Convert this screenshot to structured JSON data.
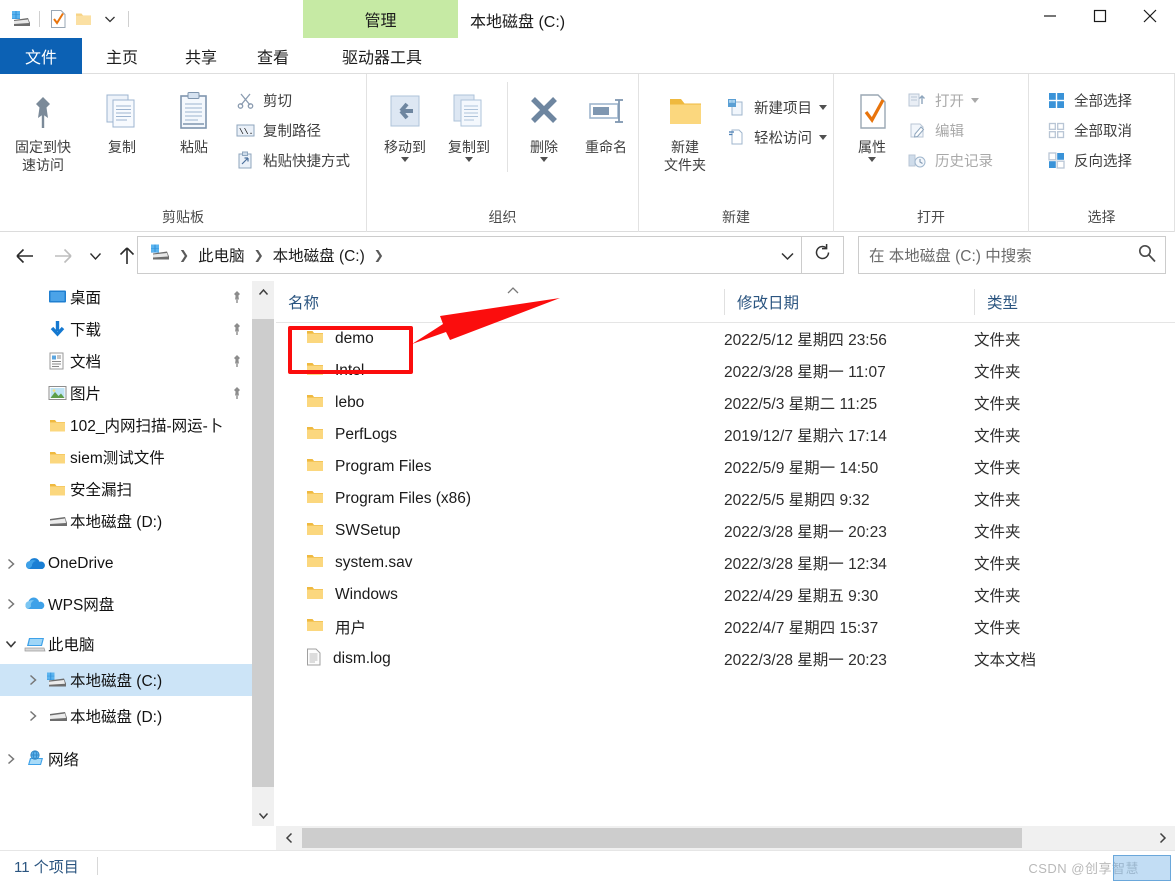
{
  "window": {
    "title": "本地磁盘 (C:)",
    "contextual_tab_header": "管理",
    "quick_access_icons": [
      "drive-icon",
      "properties-icon",
      "new-folder-icon",
      "customize-caret-icon"
    ],
    "controls": {
      "minimize": "minimize-icon",
      "maximize": "maximize-icon",
      "close": "close-icon"
    }
  },
  "tabs": [
    {
      "id": "file",
      "label": "文件"
    },
    {
      "id": "home",
      "label": "主页"
    },
    {
      "id": "share",
      "label": "共享"
    },
    {
      "id": "view",
      "label": "查看"
    },
    {
      "id": "drivetools",
      "label": "驱动器工具"
    }
  ],
  "ribbon": {
    "collapse_label": "^",
    "help_label": "?",
    "groups": [
      {
        "title": "剪贴板",
        "big_buttons": [
          {
            "label": "固定到快\n速访问",
            "line1": "固定到快",
            "line2": "速访问",
            "icon": "pin-icon"
          },
          {
            "label": "复制",
            "icon": "copy-icon"
          },
          {
            "label": "粘贴",
            "icon": "paste-icon"
          }
        ],
        "small_buttons": [
          {
            "label": "剪切",
            "icon": "scissors-icon"
          },
          {
            "label": "复制路径",
            "icon": "copy-path-icon"
          },
          {
            "label": "粘贴快捷方式",
            "icon": "paste-shortcut-icon"
          }
        ]
      },
      {
        "title": "组织",
        "big_buttons": [
          {
            "label": "移动到",
            "icon": "move-to-icon",
            "has_caret": true
          },
          {
            "label": "复制到",
            "icon": "copy-to-icon",
            "has_caret": true
          },
          {
            "label": "删除",
            "icon": "delete-icon",
            "has_caret": true
          },
          {
            "label": "重命名",
            "icon": "rename-icon"
          }
        ],
        "small_buttons": []
      },
      {
        "title": "新建",
        "big_buttons": [
          {
            "label": "新建\n文件夹",
            "line1": "新建",
            "line2": "文件夹",
            "icon": "new-folder-icon"
          }
        ],
        "small_buttons": [
          {
            "label": "新建项目",
            "icon": "new-item-icon",
            "has_caret": true
          },
          {
            "label": "轻松访问",
            "icon": "easy-access-icon",
            "has_caret": true
          }
        ]
      },
      {
        "title": "打开",
        "big_buttons": [
          {
            "label": "属性",
            "icon": "properties-icon",
            "has_caret": true
          }
        ],
        "small_buttons": [
          {
            "label": "打开",
            "icon": "open-icon",
            "has_caret": true,
            "disabled": true
          },
          {
            "label": "编辑",
            "icon": "edit-icon",
            "disabled": true
          },
          {
            "label": "历史记录",
            "icon": "history-icon",
            "disabled": true
          }
        ]
      },
      {
        "title": "选择",
        "big_buttons": [],
        "small_buttons": [
          {
            "label": "全部选择",
            "icon": "select-all-icon"
          },
          {
            "label": "全部取消",
            "icon": "select-none-icon"
          },
          {
            "label": "反向选择",
            "icon": "invert-selection-icon"
          }
        ]
      }
    ]
  },
  "address": {
    "back_icon": "back-arrow-icon",
    "forward_icon": "forward-arrow-icon",
    "recent_icon": "recent-locations-caret-icon",
    "up_icon": "up-arrow-icon",
    "breadcrumbs": [
      "此电脑",
      "本地磁盘 (C:)"
    ],
    "refresh_icon": "refresh-icon"
  },
  "search": {
    "placeholder": "在 本地磁盘 (C:) 中搜索",
    "icon": "search-icon"
  },
  "sidebar": {
    "items": [
      {
        "label": "桌面",
        "icon": "desktop-icon",
        "indent": 1,
        "chevron": "",
        "pinned": true
      },
      {
        "label": "下载",
        "icon": "downloads-icon",
        "indent": 1,
        "chevron": "",
        "pinned": true
      },
      {
        "label": "文档",
        "icon": "documents-icon",
        "indent": 1,
        "chevron": "",
        "pinned": true
      },
      {
        "label": "图片",
        "icon": "pictures-icon",
        "indent": 1,
        "chevron": "",
        "pinned": true
      },
      {
        "label": "102_内网扫描-网运-卜",
        "icon": "folder-icon",
        "indent": 1,
        "chevron": "",
        "pinned": false
      },
      {
        "label": "siem测试文件",
        "icon": "folder-icon",
        "indent": 1,
        "chevron": "",
        "pinned": false
      },
      {
        "label": "安全漏扫",
        "icon": "folder-icon",
        "indent": 1,
        "chevron": "",
        "pinned": false
      },
      {
        "label": "本地磁盘 (D:)",
        "icon": "drive-icon",
        "indent": 1,
        "chevron": "",
        "pinned": false
      },
      {
        "label": "OneDrive",
        "icon": "onedrive-icon",
        "indent": 0,
        "chevron": "right",
        "pinned": false
      },
      {
        "label": "WPS网盘",
        "icon": "wps-cloud-icon",
        "indent": 0,
        "chevron": "right",
        "pinned": false
      },
      {
        "label": "此电脑",
        "icon": "this-pc-icon",
        "indent": 0,
        "chevron": "down",
        "pinned": false
      },
      {
        "label": "本地磁盘 (C:)",
        "icon": "windows-drive-icon",
        "indent": 1,
        "chevron": "right",
        "pinned": false,
        "selected": true
      },
      {
        "label": "本地磁盘 (D:)",
        "icon": "drive-icon",
        "indent": 1,
        "chevron": "right",
        "pinned": false
      },
      {
        "label": "网络",
        "icon": "network-icon",
        "indent": 0,
        "chevron": "right",
        "pinned": false
      }
    ]
  },
  "filelist": {
    "columns": [
      "名称",
      "修改日期",
      "类型"
    ],
    "sort_indicator": "ascending",
    "rows": [
      {
        "name": "demo",
        "icon": "folder-icon",
        "date": "2022/5/12 星期四 23:56",
        "type": "文件夹",
        "highlighted": true
      },
      {
        "name": "Intel",
        "icon": "folder-icon",
        "date": "2022/3/28 星期一 11:07",
        "type": "文件夹"
      },
      {
        "name": "lebo",
        "icon": "folder-icon",
        "date": "2022/5/3 星期二 11:25",
        "type": "文件夹"
      },
      {
        "name": "PerfLogs",
        "icon": "folder-icon",
        "date": "2019/12/7 星期六 17:14",
        "type": "文件夹"
      },
      {
        "name": "Program Files",
        "icon": "folder-icon",
        "date": "2022/5/9 星期一 14:50",
        "type": "文件夹"
      },
      {
        "name": "Program Files (x86)",
        "icon": "folder-icon",
        "date": "2022/5/5 星期四 9:32",
        "type": "文件夹"
      },
      {
        "name": "SWSetup",
        "icon": "folder-icon",
        "date": "2022/3/28 星期一 20:23",
        "type": "文件夹"
      },
      {
        "name": "system.sav",
        "icon": "folder-icon",
        "date": "2022/3/28 星期一 12:34",
        "type": "文件夹"
      },
      {
        "name": "Windows",
        "icon": "folder-icon",
        "date": "2022/4/29 星期五 9:30",
        "type": "文件夹"
      },
      {
        "name": "用户",
        "icon": "folder-icon",
        "date": "2022/4/7 星期四 15:37",
        "type": "文件夹"
      },
      {
        "name": "dism.log",
        "icon": "textfile-icon",
        "date": "2022/3/28 星期一 20:23",
        "type": "文本文档"
      }
    ]
  },
  "statusbar": {
    "item_count": "11 个项目"
  },
  "annotation": {
    "highlight_target": "demo",
    "box_color": "#fb0d0d",
    "arrow_color": "#fb0d0d"
  },
  "watermark": {
    "text": "CSDN @创享智慧"
  },
  "colors": {
    "accent_blue": "#0c61b4",
    "selection_blue": "#cce4f7",
    "contextual_green": "#c6eaa4",
    "folder_yellow": "#f5cf7e",
    "annotation_red": "#fb0d0d"
  }
}
